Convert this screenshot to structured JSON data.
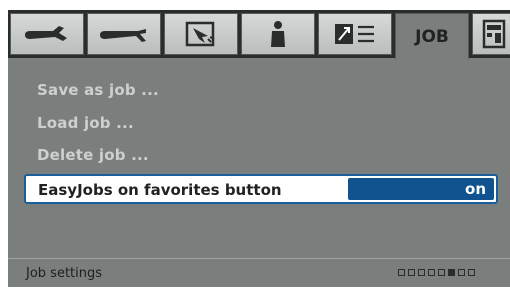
{
  "tabs": [
    {
      "icon": "welding-torch-icon",
      "active": false
    },
    {
      "icon": "wire-feed-icon",
      "active": false
    },
    {
      "icon": "weld-process-icon",
      "active": false
    },
    {
      "icon": "operator-icon",
      "active": false
    },
    {
      "icon": "settings-list-icon",
      "active": false
    },
    {
      "label": "JOB",
      "active": true
    },
    {
      "icon": "machine-panel-icon",
      "active": false
    }
  ],
  "menu": {
    "save_job": "Save as job ...",
    "load_job": "Load job ...",
    "delete_job": "Delete job  ..."
  },
  "selected": {
    "label": "EasyJobs on favorites button",
    "value": "on"
  },
  "footer": {
    "title": "Job settings",
    "page_indicator": {
      "total": 8,
      "current": 6
    }
  },
  "colors": {
    "screen_bg": "#7a7f7d",
    "selection_border": "#1a5d9b",
    "value_bg": "#11538e"
  }
}
